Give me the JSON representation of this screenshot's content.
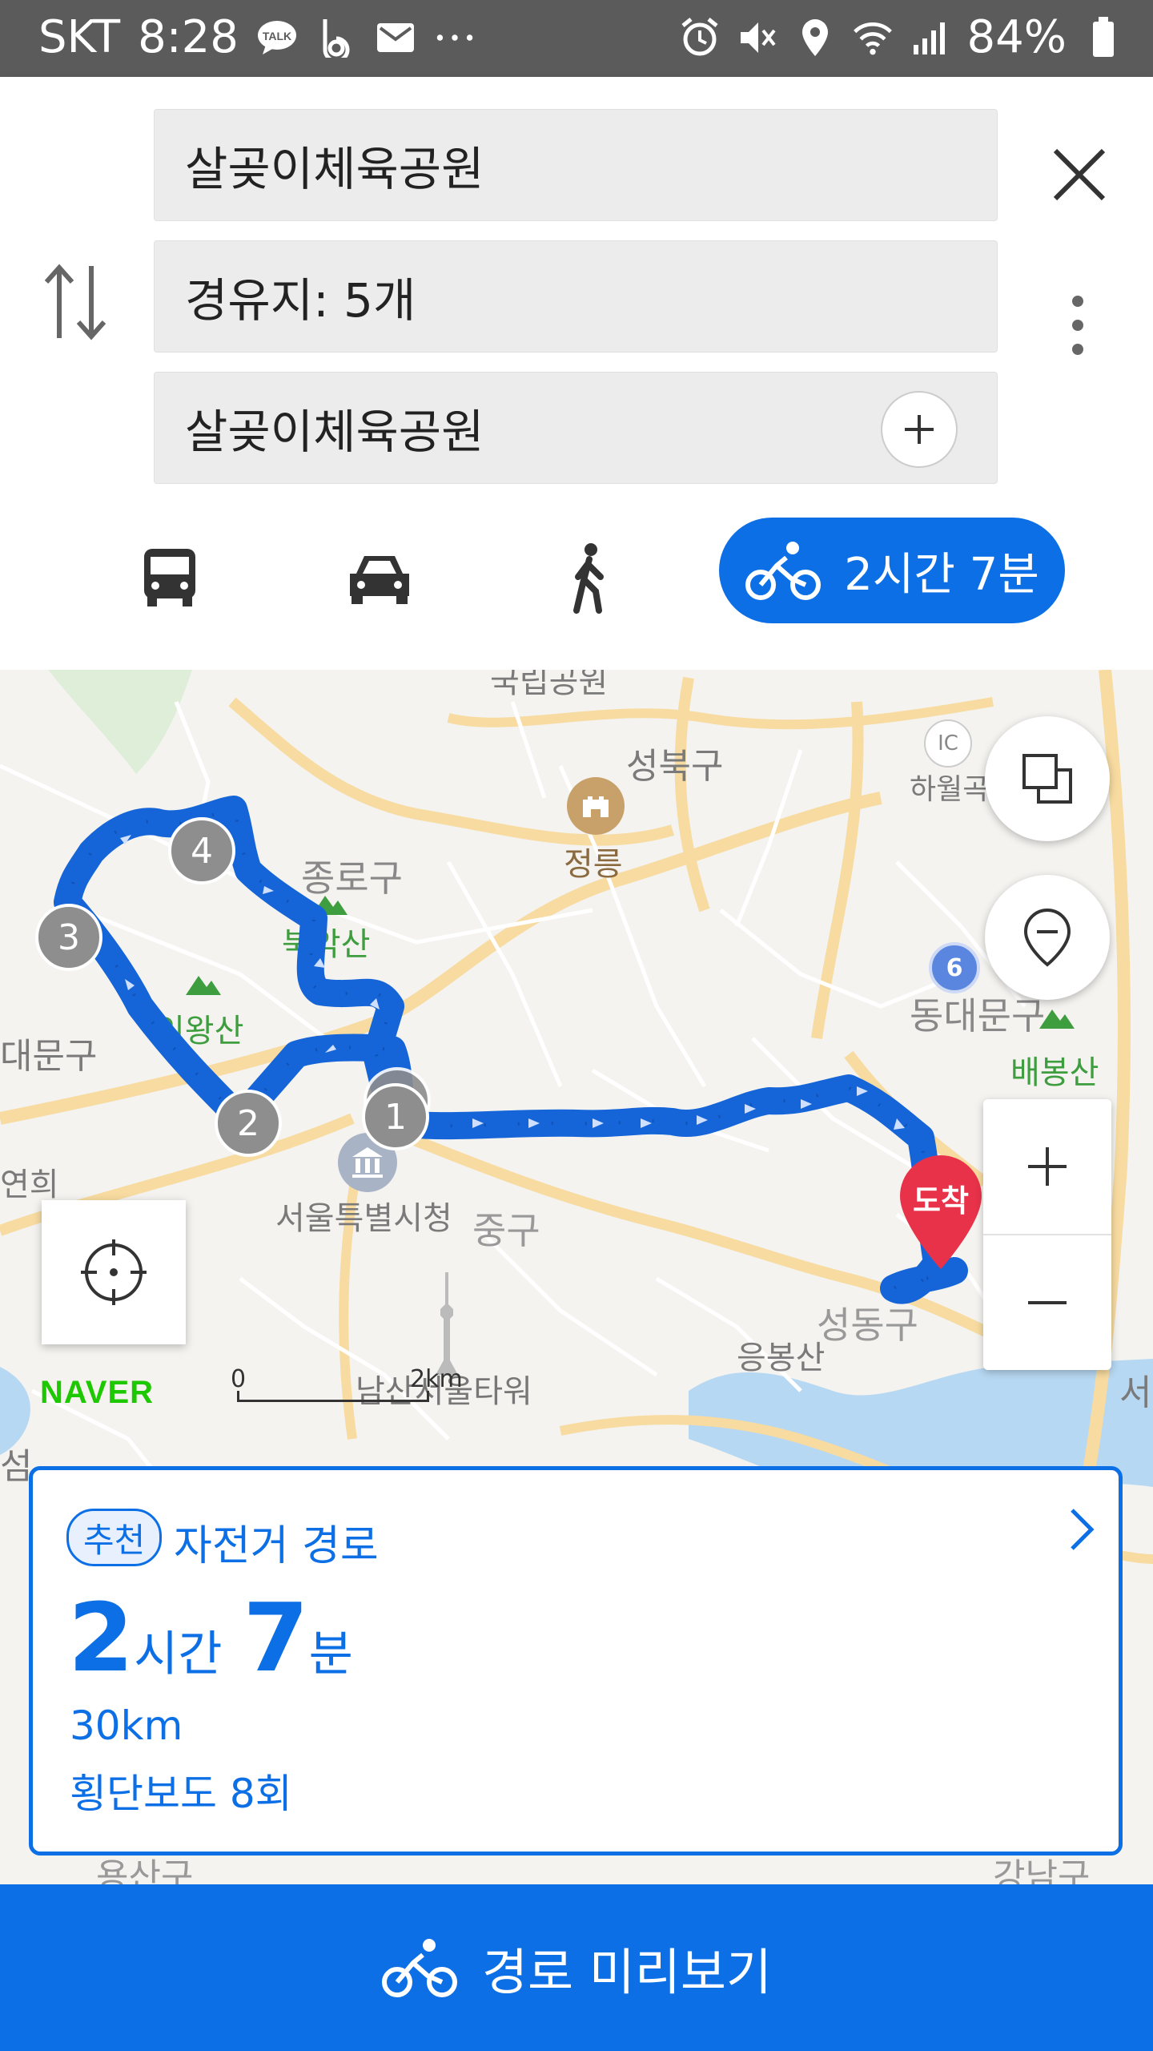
{
  "status": {
    "carrier": "SKT",
    "time": "8:28",
    "battery": "84%"
  },
  "search": {
    "origin": "살곶이체육공원",
    "waypoints": "경유지: 5개",
    "destination": "살곶이체육공원"
  },
  "modes": {
    "bike_label": "2시간 7분",
    "active": "bike"
  },
  "map": {
    "labels": {
      "seongbuk": "성북구",
      "jeongneung": "정릉",
      "jongno": "종로구",
      "bukaksan": "북악산",
      "inwangsan": "인왕산",
      "seodaemun": "대문구",
      "yeonhui": "연희",
      "cityhall": "서울특별시청",
      "junggu": "중구",
      "dongdaemun": "동대문구",
      "baebongsan": "배봉산",
      "seongdong": "성동구",
      "eungbongsan": "응봉산",
      "namsan": "남산서울타워",
      "top": "국립공원",
      "hawolgok": "하월곡",
      "ic": "IC",
      "seo": "서",
      "seom": "섬",
      "gangnam": "강남구",
      "bottom_left": "용산구",
      "route6": "6"
    },
    "markers": [
      "1",
      "2",
      "3",
      "4"
    ],
    "arrival": "도착",
    "scale_zero": "0",
    "scale_label": "2km",
    "logo": "NAVER",
    "route_color": "#1565d8",
    "arrival_color": "#e8324a"
  },
  "card": {
    "badge": "추천",
    "title": "자전거 경로",
    "hours": "2",
    "hours_unit": "시간",
    "minutes": "7",
    "minutes_unit": "분",
    "distance": "30km",
    "crosswalks": "횡단보도 8회"
  },
  "bottom_button": {
    "label": "경로 미리보기"
  },
  "colors": {
    "accent": "#0d6fe6",
    "statusbar": "#5b5b5b"
  }
}
